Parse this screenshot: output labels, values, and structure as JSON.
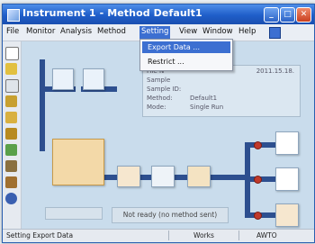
{
  "window": {
    "title": "Instrument 1 - Method Default1",
    "buttons": [
      "_",
      "□",
      "✕"
    ]
  },
  "menu": {
    "items": [
      "File",
      "Monitor",
      "Analysis",
      "Method",
      "Setting",
      "View",
      "Window",
      "Help"
    ],
    "active": "Setting"
  },
  "dropdown": {
    "items": [
      "Export Data ...",
      "Restrict ..."
    ],
    "selected": "Export Data ..."
  },
  "info": {
    "file_label": "File N",
    "date": "2011.15.18.",
    "rows": [
      {
        "label": "Sample",
        "value": ""
      },
      {
        "label": "Sample ID:",
        "value": ""
      },
      {
        "label": "Method:",
        "value": "Default1"
      },
      {
        "label": "Mode:",
        "value": "Single Run"
      }
    ]
  },
  "status_message": "Not ready (no method sent)",
  "statusbar": {
    "left": "Setting Export Data",
    "middle": "Works",
    "right": "AWTO"
  },
  "colors": {
    "titlebar": "#1f5ec9",
    "canvas": "#c9dcec",
    "pipe": "#2d4f8f",
    "valve": "#c0392b"
  }
}
